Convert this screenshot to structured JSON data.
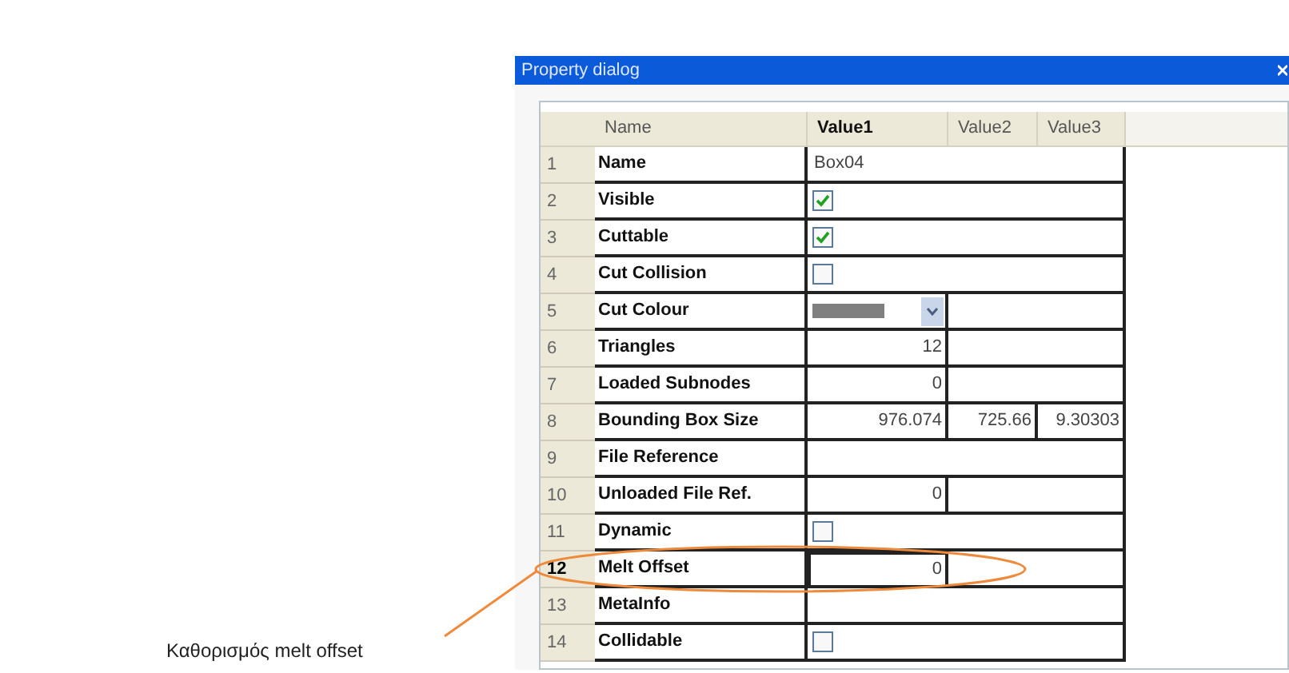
{
  "window": {
    "title": "Property dialog"
  },
  "table": {
    "columns": [
      {
        "label": "Name",
        "selected": false
      },
      {
        "label": "Value1",
        "selected": true
      },
      {
        "label": "Value2",
        "selected": false
      },
      {
        "label": "Value3",
        "selected": false
      }
    ],
    "rows": [
      {
        "index": "1",
        "name": "Name",
        "kind": "text",
        "value": "Box04",
        "selected": false
      },
      {
        "index": "2",
        "name": "Visible",
        "kind": "checkbox",
        "checked": true,
        "selected": false
      },
      {
        "index": "3",
        "name": "Cuttable",
        "kind": "checkbox",
        "checked": true,
        "selected": false
      },
      {
        "index": "4",
        "name": "Cut Collision",
        "kind": "checkbox",
        "checked": false,
        "selected": false
      },
      {
        "index": "5",
        "name": "Cut Colour",
        "kind": "color",
        "selected": false
      },
      {
        "index": "6",
        "name": "Triangles",
        "kind": "number",
        "value": "12",
        "selected": false
      },
      {
        "index": "7",
        "name": "Loaded Subnodes",
        "kind": "number",
        "value": "0",
        "selected": false
      },
      {
        "index": "8",
        "name": "Bounding Box Size",
        "kind": "vector",
        "values": [
          "976.074",
          "725.66",
          "9.30303"
        ],
        "selected": false
      },
      {
        "index": "9",
        "name": "File Reference",
        "kind": "empty",
        "selected": false
      },
      {
        "index": "10",
        "name": "Unloaded File Ref.",
        "kind": "number",
        "value": "0",
        "selected": false
      },
      {
        "index": "11",
        "name": "Dynamic",
        "kind": "checkbox",
        "checked": false,
        "selected": false
      },
      {
        "index": "12",
        "name": "Melt Offset",
        "kind": "number",
        "value": "0",
        "selected": true
      },
      {
        "index": "13",
        "name": "MetaInfo",
        "kind": "empty",
        "selected": false
      },
      {
        "index": "14",
        "name": "Collidable",
        "kind": "checkbox",
        "checked": false,
        "selected": false
      }
    ]
  },
  "annotation": {
    "caption": "Καθορισμός melt offset"
  }
}
